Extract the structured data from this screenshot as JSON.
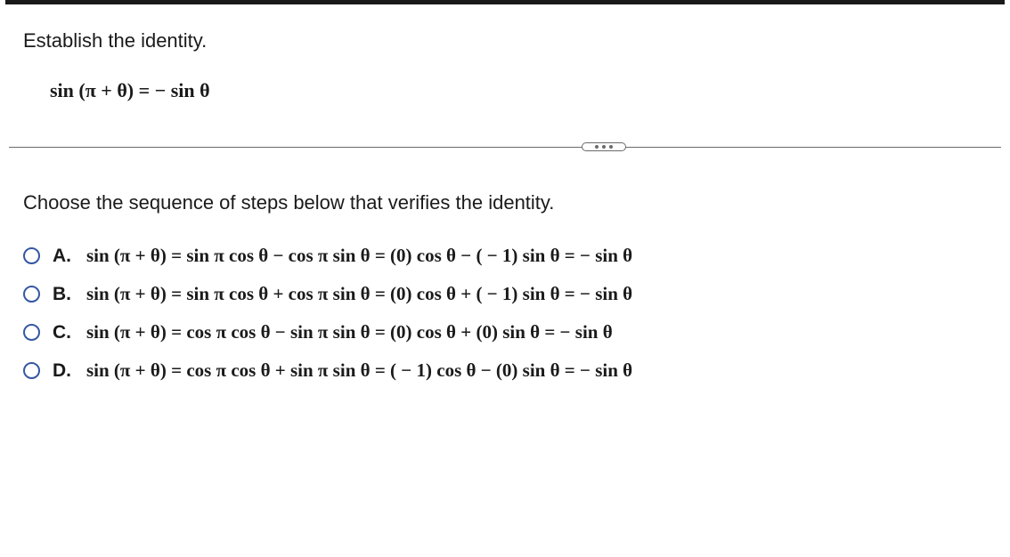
{
  "prompt": "Establish the identity.",
  "identity_html": "sin (π + θ) = − sin θ",
  "separator_label": "...",
  "question": "Choose the sequence of steps below that verifies the identity.",
  "options": [
    {
      "letter": "A.",
      "math": "sin (π + θ) = sin π cos θ − cos π sin θ = (0) cos θ − ( − 1) sin θ = − sin θ"
    },
    {
      "letter": "B.",
      "math": "sin (π + θ) = sin π cos θ + cos π sin θ = (0) cos θ + ( − 1) sin θ = − sin θ"
    },
    {
      "letter": "C.",
      "math": "sin (π + θ) = cos π cos θ − sin π sin θ = (0) cos θ + (0) sin θ = − sin θ"
    },
    {
      "letter": "D.",
      "math": "sin (π + θ) = cos π cos θ + sin π sin θ = ( − 1) cos θ − (0) sin θ = − sin θ"
    }
  ]
}
